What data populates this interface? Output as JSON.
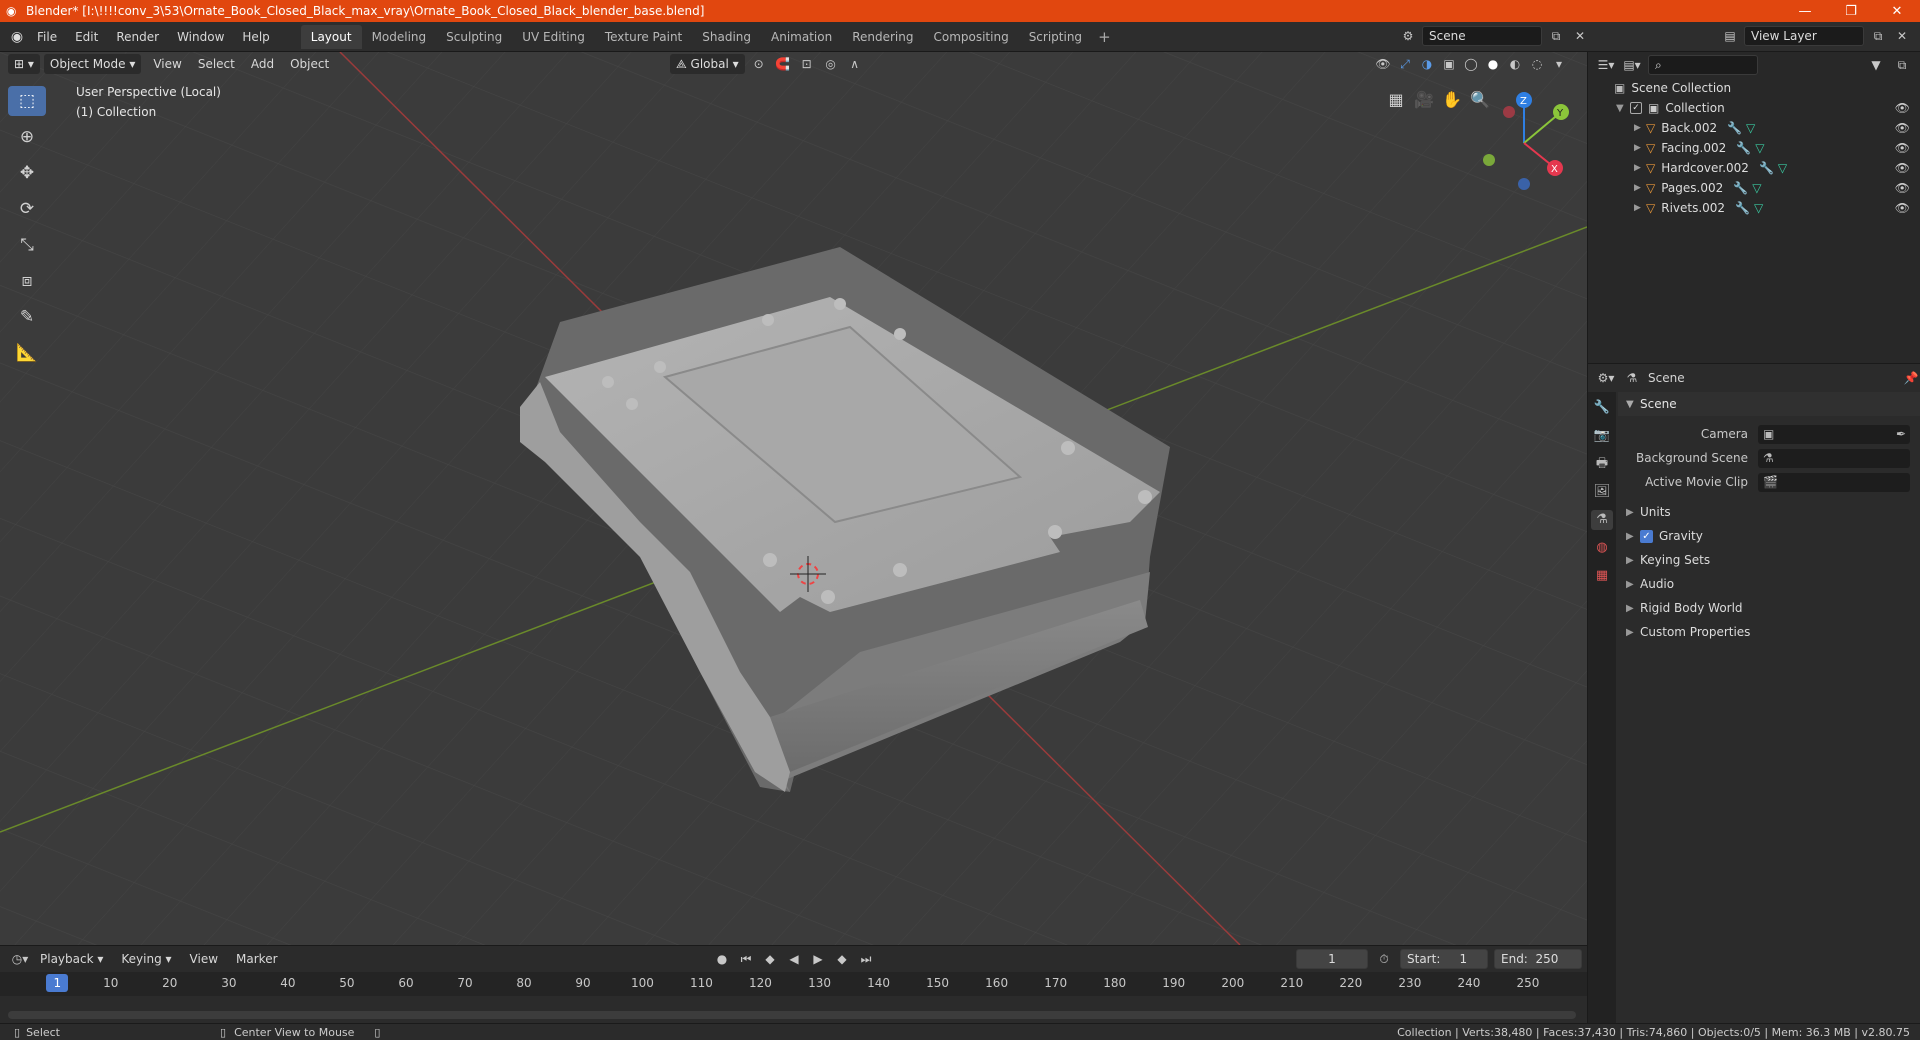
{
  "window": {
    "title": "Blender* [I:\\!!!!conv_3\\53\\Ornate_Book_Closed_Black_max_vray\\Ornate_Book_Closed_Black_blender_base.blend]",
    "min": "—",
    "max": "❐",
    "close": "✕"
  },
  "menu": [
    "File",
    "Edit",
    "Render",
    "Window",
    "Help"
  ],
  "workspaces": {
    "tabs": [
      "Layout",
      "Modeling",
      "Sculpting",
      "UV Editing",
      "Texture Paint",
      "Shading",
      "Animation",
      "Rendering",
      "Compositing",
      "Scripting"
    ],
    "active": "Layout",
    "add": "+"
  },
  "scene": {
    "name": "Scene"
  },
  "view_layer": {
    "name": "View Layer"
  },
  "viewport": {
    "mode": "Object Mode",
    "menus": [
      "View",
      "Select",
      "Add",
      "Object"
    ],
    "transform": "Global",
    "overlay_line1": "User Perspective (Local)",
    "overlay_line2": "(1) Collection",
    "axes": {
      "x": "X",
      "y": "Y",
      "z": "Z"
    },
    "colors": {
      "x": "#e5384f",
      "y": "#8bc53a",
      "z": "#2f7fe3"
    }
  },
  "outliner": {
    "root": "Scene Collection",
    "collection": "Collection",
    "objects": [
      "Back.002",
      "Facing.002",
      "Hardcover.002",
      "Pages.002",
      "Rivets.002"
    ]
  },
  "properties": {
    "header": "Scene",
    "panel": "Scene",
    "camera_label": "Camera",
    "bg_label": "Background Scene",
    "clip_label": "Active Movie Clip",
    "subpanels": [
      "Units",
      "Gravity",
      "Keying Sets",
      "Audio",
      "Rigid Body World",
      "Custom Properties"
    ],
    "gravity_checked": true
  },
  "timeline": {
    "menus": [
      "Playback",
      "Keying",
      "View",
      "Marker"
    ],
    "current_frame": "1",
    "start_label": "Start:",
    "start": "1",
    "end_label": "End:",
    "end": "250",
    "ticks": [
      "1",
      "10",
      "20",
      "30",
      "40",
      "50",
      "60",
      "70",
      "80",
      "90",
      "100",
      "110",
      "120",
      "130",
      "140",
      "150",
      "160",
      "170",
      "180",
      "190",
      "200",
      "210",
      "220",
      "230",
      "240",
      "250"
    ]
  },
  "status": {
    "left1": "Select",
    "left2": "Center View to Mouse",
    "right": "Collection | Verts:38,480 | Faces:37,430 | Tris:74,860 | Objects:0/5 | Mem: 36.3 MB | v2.80.75"
  }
}
